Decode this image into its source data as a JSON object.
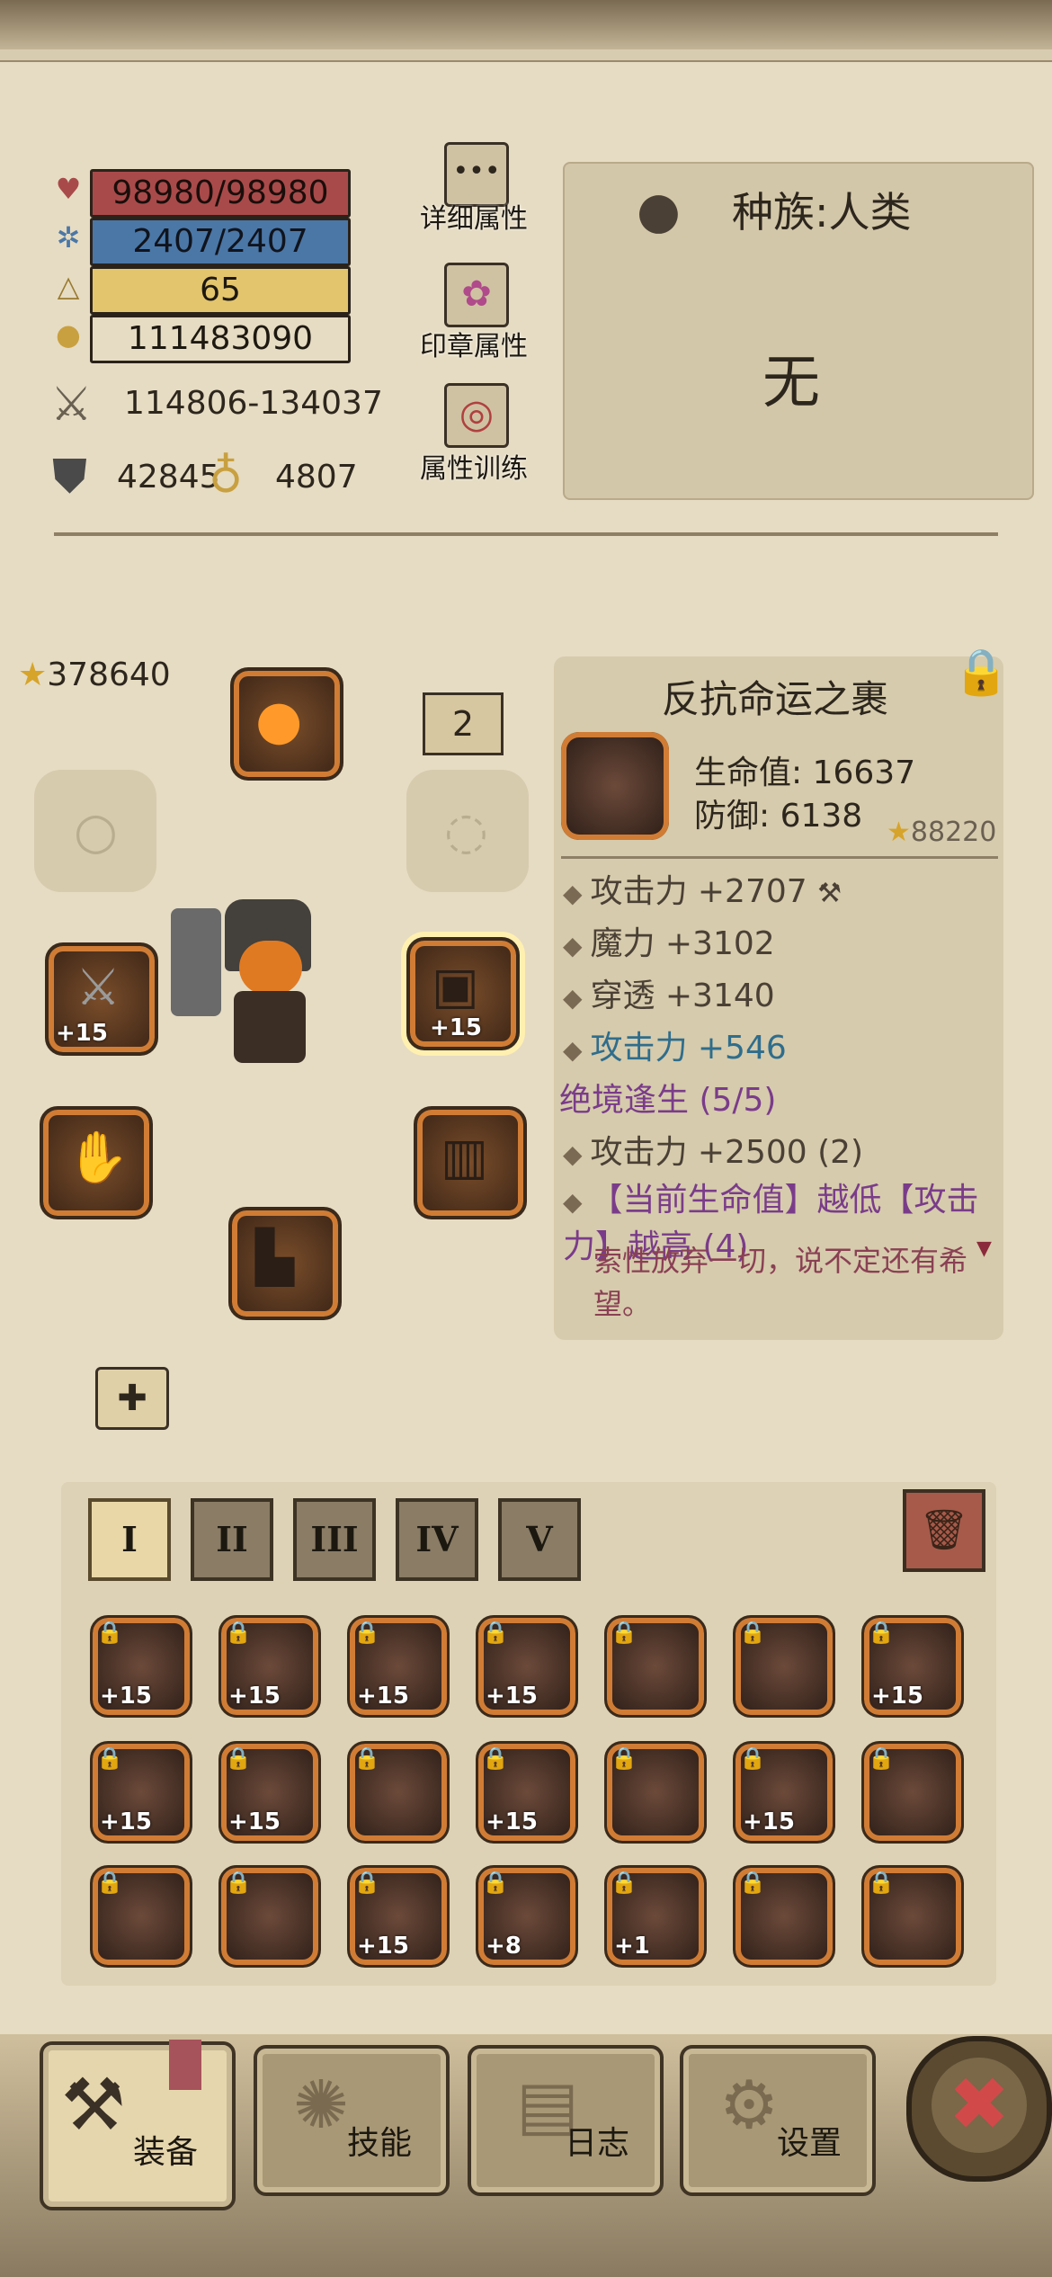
{
  "stats": {
    "hp": "98980/98980",
    "mp": "2407/2407",
    "level": "65",
    "gold": "111483090",
    "attack": "114806-134037",
    "defense": "42845",
    "resource": "4807"
  },
  "top_buttons": {
    "details": "详细属性",
    "seal": "印章属性",
    "training": "属性训练"
  },
  "race": {
    "title": "种族:人类",
    "value": "无"
  },
  "power": "378640",
  "slot_badge": "2",
  "slots": {
    "weapon_plus": "+15",
    "chest_plus": "+15"
  },
  "item": {
    "name": "反抗命运之裹",
    "hp": "生命值: 16637",
    "def": "防御: 6138",
    "score": "88220",
    "attrs": [
      "攻击力 +2707",
      "魔力 +3102",
      "穿透 +3140",
      "攻击力 +546"
    ],
    "set_name": "绝境逢生 (5/5)",
    "set_attr1": "攻击力 +2500 (2)",
    "set_attr2": "【当前生命值】越低【攻击力】越高 (4)",
    "flavor": "索性放弃一切，说不定还有希望。"
  },
  "tabs": [
    "I",
    "II",
    "III",
    "IV",
    "V"
  ],
  "inventory": [
    [
      "+15",
      "+15",
      "+15",
      "+15",
      "",
      "",
      "+15"
    ],
    [
      "+15",
      "+15",
      "",
      "+15",
      "",
      "+15",
      ""
    ],
    [
      "",
      "",
      "+15",
      "+8",
      "+1",
      "",
      ""
    ]
  ],
  "nav": {
    "equip": "装备",
    "skill": "技能",
    "log": "日志",
    "settings": "设置"
  },
  "colors": {
    "hp": "#a94a4a",
    "mp": "#4b77a6",
    "level": "#e3c56d",
    "slot_frame": "#d07c35",
    "set_color": "#7a3c8a",
    "attr_blue": "#2f6d8c"
  }
}
